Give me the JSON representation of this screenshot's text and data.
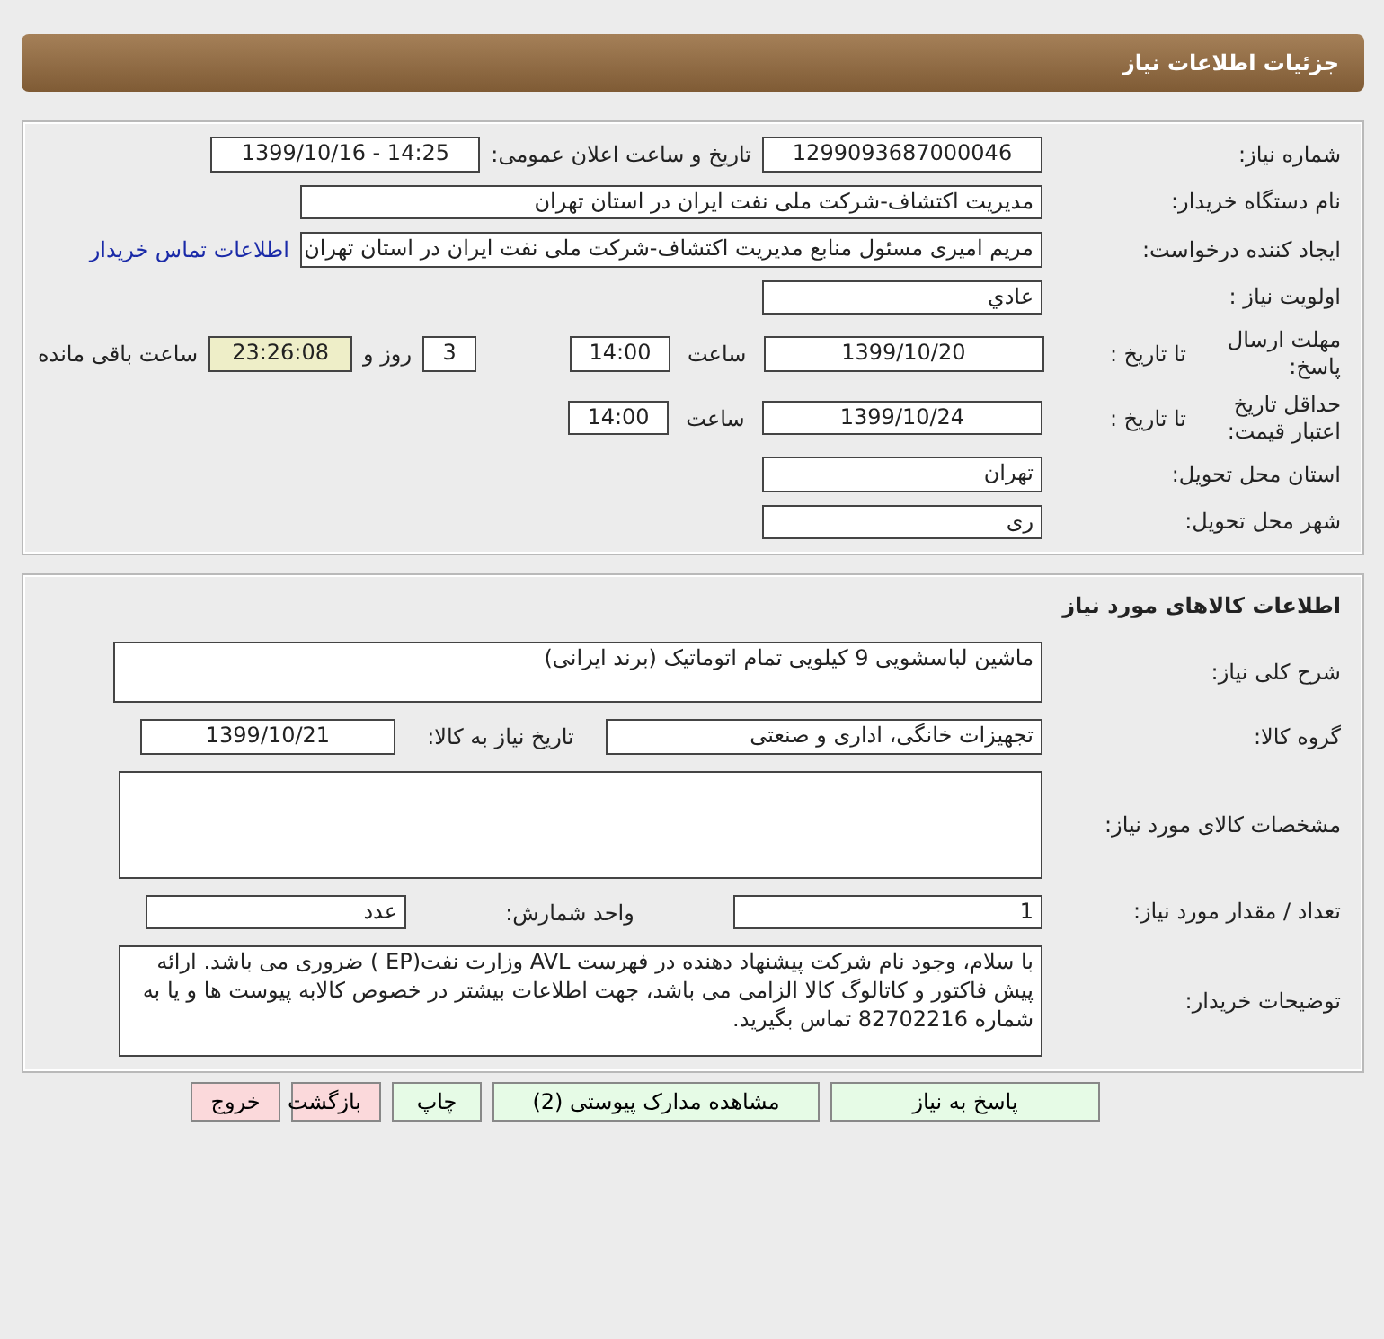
{
  "header": {
    "title": "جزئیات اطلاعات نیاز"
  },
  "need_info": {
    "need_number": {
      "label": "شماره نیاز:",
      "value": "1299093687000046"
    },
    "announce": {
      "label": "تاریخ و ساعت اعلان عمومی:",
      "value": "1399/10/16 - 14:25"
    },
    "buyer_org": {
      "label": "نام دستگاه خریدار:",
      "value": "مدیریت اکتشاف-شرکت ملی نفت ایران در استان تهران"
    },
    "requester": {
      "label": "ایجاد کننده درخواست:",
      "value": "مریم امیری مسئول منابع مدیریت اکتشاف-شرکت ملی نفت ایران در استان تهران",
      "link": "اطلاعات تماس خریدار"
    },
    "priority": {
      "label": "اولویت نیاز :",
      "value": "عادي"
    },
    "reply_deadline": {
      "label": "مهلت ارسال پاسخ:",
      "to_date_label": "تا تاریخ :",
      "date": "1399/10/20",
      "time_label": "ساعت",
      "time": "14:00",
      "days": "3",
      "days_label": "روز و",
      "remaining": "23:26:08",
      "remaining_label": "ساعت باقی مانده"
    },
    "price_validity": {
      "label": "حداقل تاریخ اعتبار قیمت:",
      "to_date_label": "تا تاریخ :",
      "date": "1399/10/24",
      "time_label": "ساعت",
      "time": "14:00"
    },
    "province": {
      "label": "استان محل تحویل:",
      "value": "تهران"
    },
    "city": {
      "label": "شهر محل تحویل:",
      "value": "ری"
    }
  },
  "goods": {
    "title": "اطلاعات کالاهای مورد نیاز",
    "description": {
      "label": "شرح کلی نیاز:",
      "value": "ماشین لباسشویی 9 کیلویی تمام اتوماتیک (برند ایرانی)"
    },
    "group": {
      "label": "گروه کالا:",
      "value": "تجهیزات خانگی، اداری و صنعتی"
    },
    "need_date": {
      "label": "تاریخ نیاز به کالا:",
      "value": "1399/10/21"
    },
    "specs": {
      "label": "مشخصات کالای مورد نیاز:"
    },
    "quantity": {
      "label": "تعداد / مقدار مورد نیاز:",
      "value": "1"
    },
    "unit": {
      "label": "واحد شمارش:",
      "value": "عدد"
    },
    "notes": {
      "label": "توضیحات خریدار:",
      "value": "با سلام، وجود نام شرکت پیشنهاد دهنده در فهرست AVL وزارت نفت(EP ) ضروری می باشد. ارائه پیش فاکتور و کاتالوگ کالا الزامی می باشد، جهت اطلاعات بیشتر در خصوص کالابه پیوست ها و یا به شماره 82702216 تماس بگیرید."
    }
  },
  "buttons": [
    {
      "label": "پاسخ به نیاز",
      "kind": "primary"
    },
    {
      "label": "مشاهده مدارک پیوستی (2)",
      "kind": "primary"
    },
    {
      "label": "چاپ",
      "kind": "primary"
    },
    {
      "label": "بازگشت",
      "kind": "danger"
    },
    {
      "label": "خروج",
      "kind": "danger"
    }
  ]
}
